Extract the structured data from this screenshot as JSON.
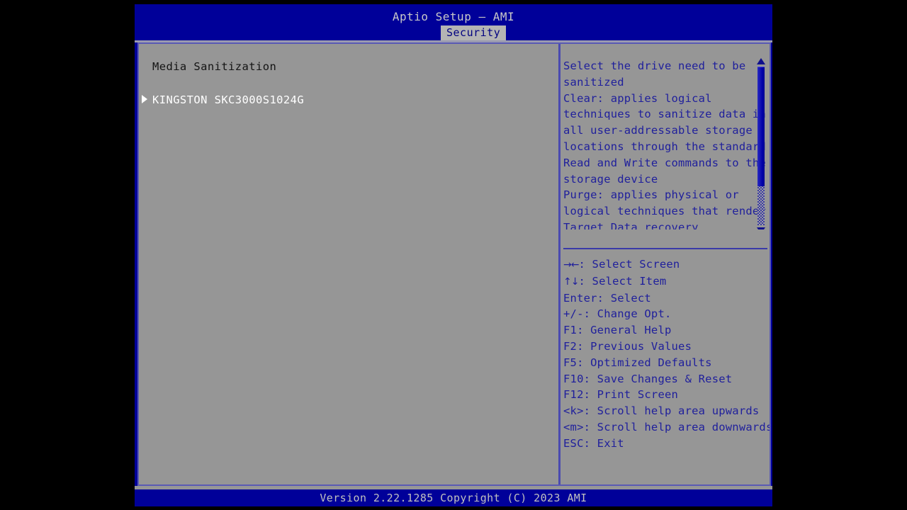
{
  "colors": {
    "screen_background": "#000000",
    "header_blue": "#000099",
    "panel_gray": "#969696",
    "help_text_blue": "#20209c",
    "tab_background": "#b4b4b4",
    "tab_text": "#000080",
    "selected_item_white": "#ffffff",
    "section_title_dark": "#141414",
    "panel_border": "#5a5ab4"
  },
  "header": {
    "title": "Aptio Setup – AMI",
    "tabs": [
      {
        "label": "Security",
        "active": true
      }
    ]
  },
  "left_pane": {
    "section_title": "Media Sanitization",
    "items": [
      {
        "label": "KINGSTON SKC3000S1024G",
        "marker": "submenu-triangle-icon",
        "selected": true
      }
    ]
  },
  "right_pane": {
    "help": {
      "lines": [
        "Select the drive need to be",
        "sanitized",
        "Clear: applies logical",
        "techniques to sanitize data in",
        "all user-addressable storage",
        "locations through the standard",
        "Read and Write commands to the",
        "storage device",
        "Purge: applies physical or",
        "logical techniques that render",
        "Target Data recovery"
      ],
      "scrollbar": {
        "up_arrow": "scroll-up-arrow-icon",
        "down_arrow": "scroll-down-arrow-icon",
        "thumb_percent": 75
      }
    },
    "keys": [
      {
        "glyph": "→←",
        "text": ": Select Screen"
      },
      {
        "glyph": "↑↓",
        "text": ": Select Item"
      },
      {
        "glyph": "",
        "text": "Enter: Select"
      },
      {
        "glyph": "",
        "text": "+/-: Change Opt."
      },
      {
        "glyph": "",
        "text": "F1: General Help"
      },
      {
        "glyph": "",
        "text": "F2: Previous Values"
      },
      {
        "glyph": "",
        "text": "F5: Optimized Defaults"
      },
      {
        "glyph": "",
        "text": "F10: Save Changes & Reset"
      },
      {
        "glyph": "",
        "text": "F12: Print Screen"
      },
      {
        "glyph": "",
        "text": "<k>: Scroll help area upwards"
      },
      {
        "glyph": "",
        "text": "<m>: Scroll help area downwards"
      },
      {
        "glyph": "",
        "text": "ESC: Exit"
      }
    ]
  },
  "footer": {
    "version_text": "Version 2.22.1285 Copyright (C) 2023 AMI"
  }
}
